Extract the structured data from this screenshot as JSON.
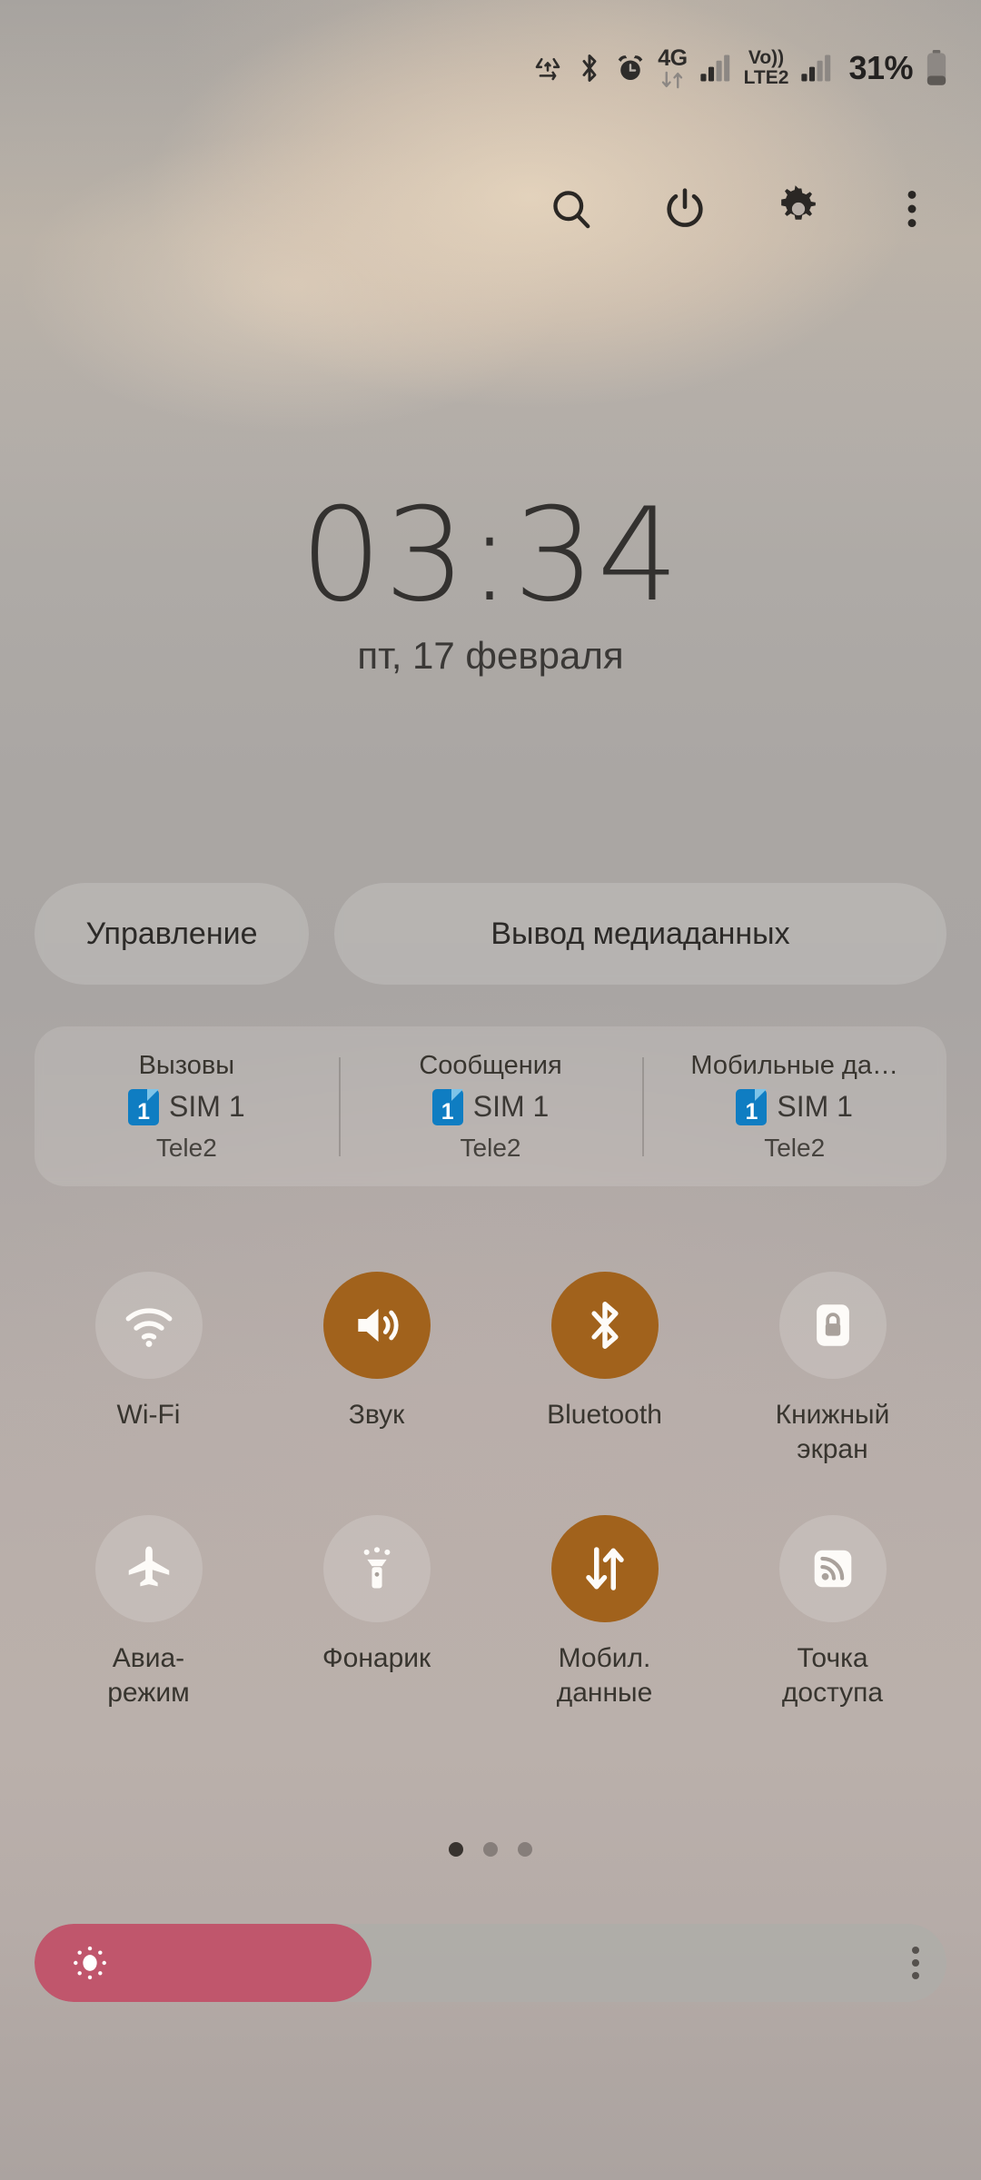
{
  "statusbar": {
    "icons": [
      {
        "name": "data-saver-icon",
        "label": "data saver"
      },
      {
        "name": "bluetooth-icon",
        "label": "Bluetooth"
      },
      {
        "name": "alarm-icon",
        "label": "alarm"
      },
      {
        "name": "network-4g-icon",
        "label": "4G"
      },
      {
        "name": "signal-bars-sim1-icon",
        "label": "signal SIM 1"
      },
      {
        "name": "volte-lte2-icon",
        "label": "VoLTE2"
      },
      {
        "name": "signal-bars-sim2-icon",
        "label": "signal SIM 2"
      }
    ],
    "network_type": "4G",
    "volte_label_top": "Vo))",
    "volte_label_bottom": "LTE2",
    "battery_percent": "31%"
  },
  "toolbar": {
    "search_label": "search-icon",
    "power_label": "power-icon",
    "settings_label": "gear-icon",
    "more_label": "more-options-icon"
  },
  "clock": {
    "time": "03:34",
    "date": "пт, 17 февраля"
  },
  "pills": {
    "control": "Управление",
    "media_output": "Вывод медиаданных"
  },
  "sim_panel": {
    "columns": [
      {
        "title": "Вызовы",
        "sim_number": "1",
        "sim_name": "SIM 1",
        "carrier": "Tele2"
      },
      {
        "title": "Сообщения",
        "sim_number": "1",
        "sim_name": "SIM 1",
        "carrier": "Tele2"
      },
      {
        "title": "Мобильные да…",
        "sim_number": "1",
        "sim_name": "SIM 1",
        "carrier": "Tele2"
      }
    ]
  },
  "toggles": [
    {
      "label": "Wi-Fi",
      "icon": "wifi-icon",
      "state": "off"
    },
    {
      "label": "Звук",
      "icon": "volume-icon",
      "state": "on"
    },
    {
      "label": "Bluetooth",
      "icon": "bluetooth-icon",
      "state": "on"
    },
    {
      "label": "Книжный\nэкран",
      "icon": "rotation-lock-icon",
      "state": "off"
    },
    {
      "label": "Авиа-\nрежим",
      "icon": "airplane-icon",
      "state": "off"
    },
    {
      "label": "Фонарик",
      "icon": "flashlight-icon",
      "state": "off"
    },
    {
      "label": "Мобил.\nданные",
      "icon": "mobile-data-icon",
      "state": "on"
    },
    {
      "label": "Точка\nдоступа",
      "icon": "hotspot-icon",
      "state": "off"
    }
  ],
  "page_indicator": {
    "total": 3,
    "active": 1
  },
  "brightness": {
    "value_percent": 37,
    "icon": "brightness-sun-icon",
    "more_icon": "more-options-icon"
  },
  "colors": {
    "accent_on": "#a1621c",
    "brightness_fill": "#c0566c",
    "sim_badge": "#0f7dc2",
    "text_primary": "#33312f"
  }
}
